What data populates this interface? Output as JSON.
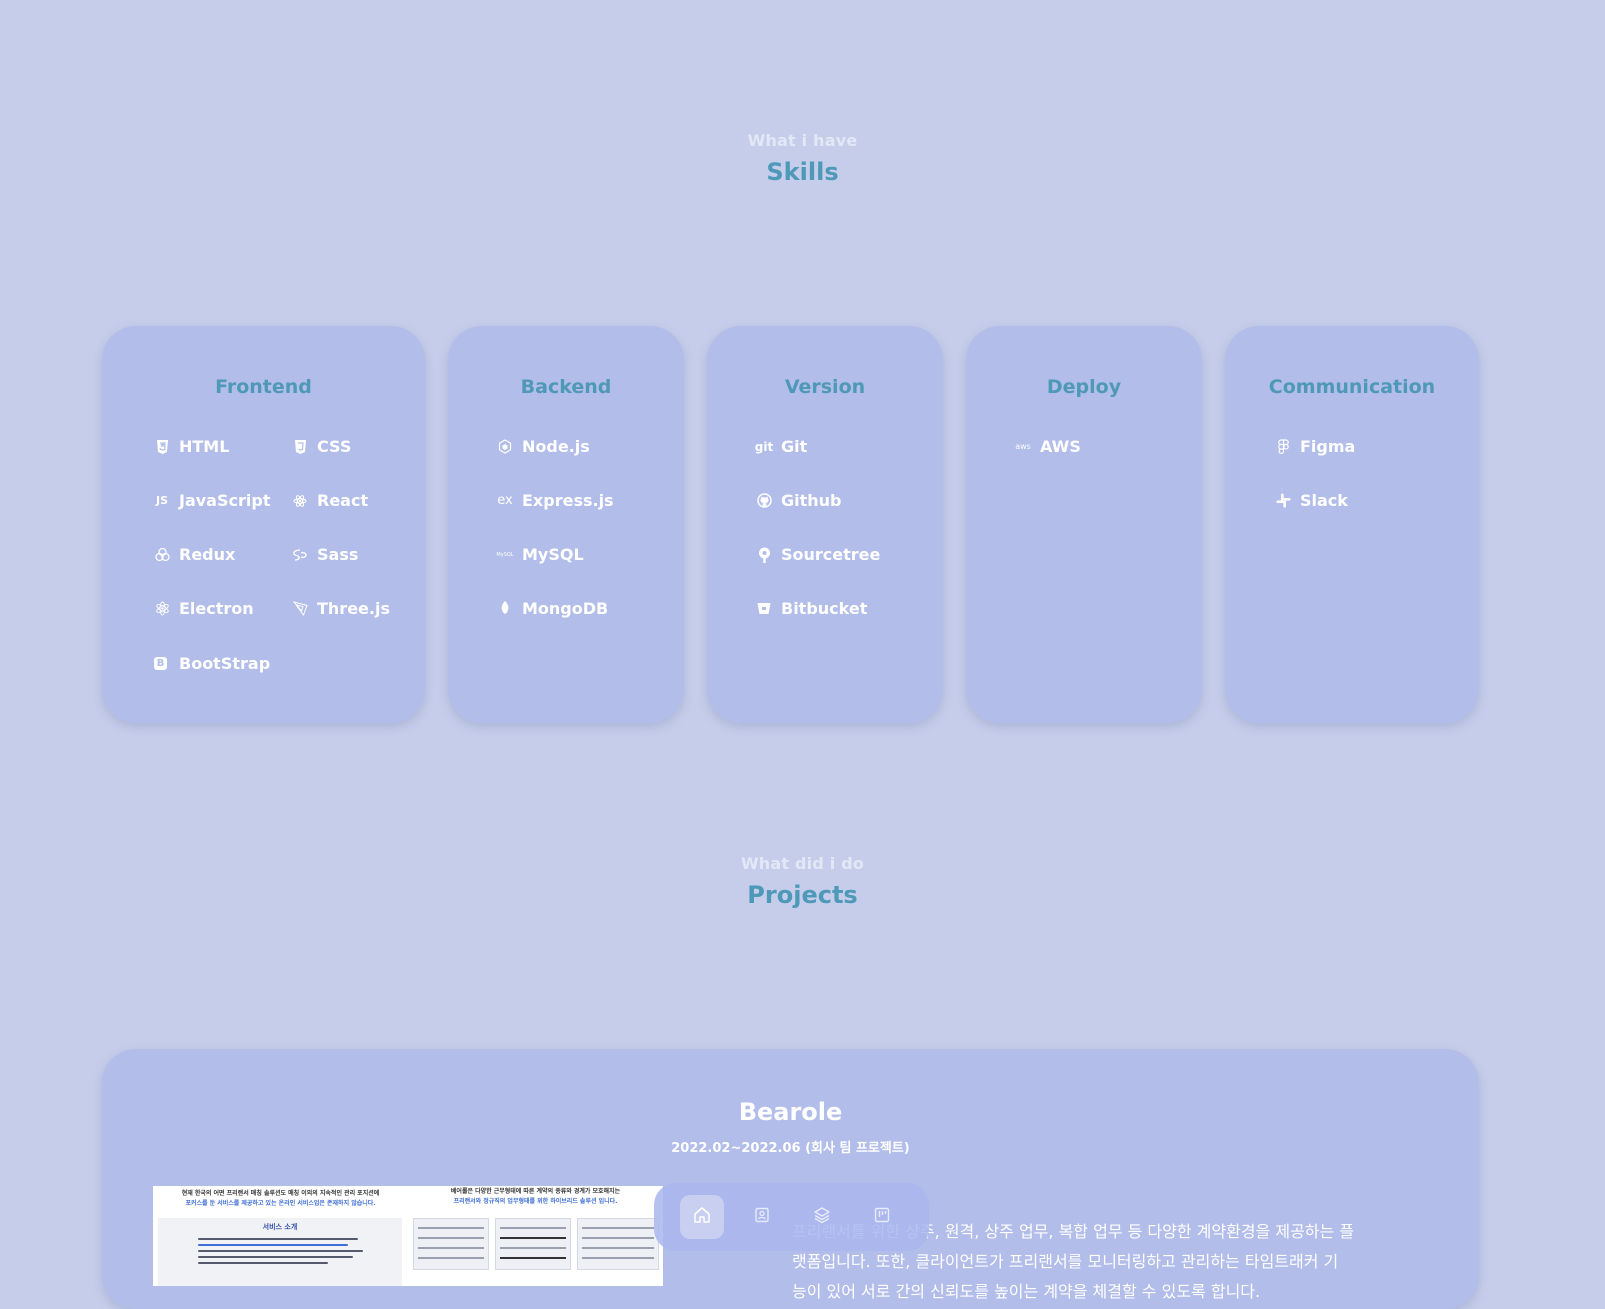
{
  "skills_section": {
    "eyebrow": "What i have",
    "title": "Skills"
  },
  "skill_cards": [
    {
      "title": "Frontend",
      "items": [
        {
          "label": "HTML",
          "icon": "html5-icon"
        },
        {
          "label": "CSS",
          "icon": "css3-icon"
        },
        {
          "label": "JavaScript",
          "icon": "javascript-icon",
          "glyph": "JS"
        },
        {
          "label": "React",
          "icon": "react-icon"
        },
        {
          "label": "Redux",
          "icon": "redux-icon"
        },
        {
          "label": "Sass",
          "icon": "sass-icon"
        },
        {
          "label": "Electron",
          "icon": "electron-icon"
        },
        {
          "label": "Three.js",
          "icon": "threejs-icon"
        },
        {
          "label": "BootStrap",
          "icon": "bootstrap-icon",
          "glyph": "B"
        }
      ]
    },
    {
      "title": "Backend",
      "items": [
        {
          "label": "Node.js",
          "icon": "nodejs-icon"
        },
        {
          "label": "Express.js",
          "icon": "express-icon",
          "glyph": "ex"
        },
        {
          "label": "MySQL",
          "icon": "mysql-icon",
          "glyph": "MySQL"
        },
        {
          "label": "MongoDB",
          "icon": "mongodb-icon"
        }
      ]
    },
    {
      "title": "Version",
      "items": [
        {
          "label": "Git",
          "icon": "git-icon",
          "glyph": "git"
        },
        {
          "label": "Github",
          "icon": "github-icon"
        },
        {
          "label": "Sourcetree",
          "icon": "sourcetree-icon"
        },
        {
          "label": "Bitbucket",
          "icon": "bitbucket-icon"
        }
      ]
    },
    {
      "title": "Deploy",
      "items": [
        {
          "label": "AWS",
          "icon": "aws-icon",
          "glyph": "aws"
        }
      ]
    },
    {
      "title": "Communication",
      "items": [
        {
          "label": "Figma",
          "icon": "figma-icon"
        },
        {
          "label": "Slack",
          "icon": "slack-icon"
        }
      ]
    }
  ],
  "projects_section": {
    "eyebrow": "What did i do",
    "title": "Projects"
  },
  "project": {
    "title": "Bearole",
    "period": "2022.02~2022.06 (회사 팀 프로젝트)",
    "screenshot_left": {
      "heading_line1": "현재 한국의 어떤 프리랜서 매칭 솔루션도 매칭 이외의 지속적인 관리 포지션에",
      "heading_line2": "포커스를 둔 서비스를 제공하고 있는 온라인 서비스업은 존재하지 않습니다.",
      "subheading": "서비스 소개"
    },
    "screenshot_right": {
      "heading_line1": "베어롤은 다양한 근무형태에 따른 계약의 종류와 경계가 모호해지는",
      "heading_line2": "프리랜서와 정규직의 업무형태를 위한 하이브리드 솔루션 입니다."
    },
    "description_line1": "프리랜서를 위한 상주, 원격, 상주 업무, 복합 업무 등 다양한 계약환경을 제공하는 플",
    "description_line2": "랫폼입니다. 또한, 클라이언트가 프리랜서를 모니터링하고 관리하는 타임트래커 기",
    "description_line3": "능이 있어 서로 간의 신뢰도를 높이는 계약을 체결할 수 있도록 합니다."
  },
  "navbar": {
    "items": [
      {
        "icon": "home-icon",
        "active": true
      },
      {
        "icon": "contact-card-icon",
        "active": false
      },
      {
        "icon": "layers-icon",
        "active": false
      },
      {
        "icon": "projects-board-icon",
        "active": false
      }
    ]
  },
  "colors": {
    "background": "#c5cdea",
    "card": "#b2bde9",
    "accent": "#4e98b8",
    "text": "#ffffff"
  }
}
